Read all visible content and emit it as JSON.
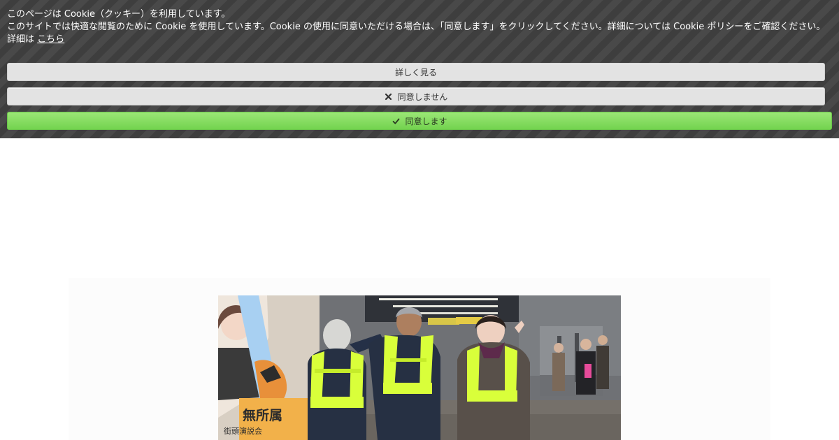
{
  "cookie_banner": {
    "title": "このページは Cookie（クッキー）を利用しています。",
    "description": "このサイトでは快適な閲覧のために Cookie を使用しています。Cookie の使用に同意いただける場合は、「同意します」をクリックしてください。詳細については Cookie ポリシーをご確認ください。",
    "details_prefix": "詳細は",
    "details_link": "こちら",
    "learn_more_label": "詳しく見る",
    "decline_label": "同意しません",
    "accept_label": "同意します",
    "decline_icon": "close-icon",
    "accept_icon": "check-icon",
    "accent_color": "#7fdb5a",
    "background_color": "#3e3e3e"
  },
  "hero": {
    "poster_text_1": "無所属",
    "poster_text_2": "街頭演説会"
  }
}
